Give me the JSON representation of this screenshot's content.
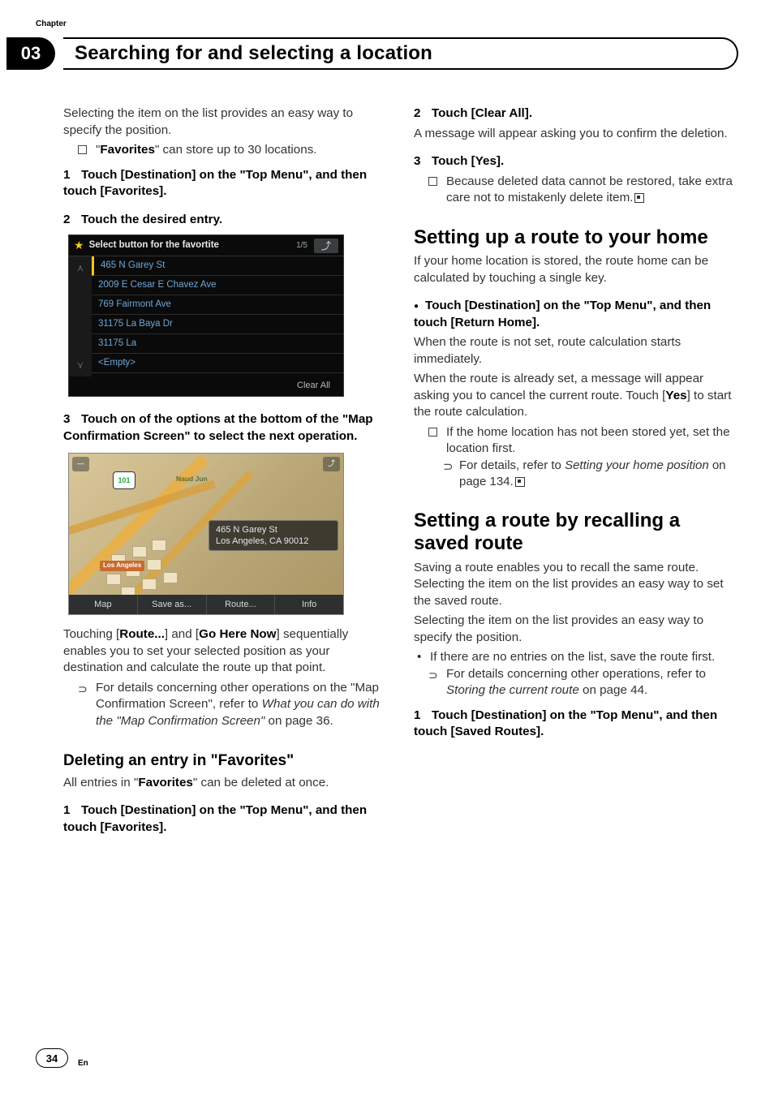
{
  "chapter_label": "Chapter",
  "chapter_number": "03",
  "page_title": "Searching for and selecting a location",
  "page_number": "34",
  "lang_label": "En",
  "left": {
    "intro1": "Selecting the item on the list provides an easy way to specify the position.",
    "note_fav_limit_pre": "\"",
    "note_fav_limit_bold": "Favorites",
    "note_fav_limit_post": "\" can store up to 30 locations.",
    "step1": "Touch [Destination] on the \"Top Menu\", and then touch [Favorites].",
    "step2": "Touch the desired entry.",
    "fav_screen": {
      "title": "Select button for the favortite",
      "page": "1/5",
      "rows": [
        "465 N Garey St",
        "2009 E Cesar E Chavez Ave",
        "769 Fairmont Ave",
        "31175 La Baya Dr",
        "31175 La",
        "<Empty>"
      ],
      "clear": "Clear All"
    },
    "step3": "Touch on of the options at the bottom of the \"Map Confirmation Screen\" to select the next operation.",
    "map_screen": {
      "shield": "101",
      "neighborhood": "Naud Jun",
      "city_label": "Los Angeles",
      "addr_line1": "465 N Garey St",
      "addr_line2": "Los Angeles, CA 90012",
      "buttons": [
        "Map",
        "Save as...",
        "Route...",
        "Info"
      ]
    },
    "route_para_1": "Touching [",
    "route_para_b1": "Route...",
    "route_para_2": "] and [",
    "route_para_b2": "Go Here Now",
    "route_para_3": "] sequentially enables you to set your selected position as your destination and calculate the route up that point.",
    "detail_ref_1": "For details concerning other operations on the \"Map Confirmation Screen\", refer to ",
    "detail_ref_it": "What you can do with the \"Map Confirmation Screen\"",
    "detail_ref_2": " on page 36.",
    "del_heading_1": "Deleting an entry in ",
    "del_heading_2": "\"Favorites\"",
    "del_intro_1": "All entries in \"",
    "del_intro_b": "Favorites",
    "del_intro_2": "\" can be deleted at once.",
    "del_step1": "Touch [Destination] on the \"Top Menu\", and then touch [Favorites]."
  },
  "right": {
    "step2": "Touch [Clear All].",
    "step2_body": "A message will appear asking you to confirm the deletion.",
    "step3": "Touch [Yes].",
    "step3_note": "Because deleted data cannot be restored, take extra care not to mistakenly delete item.",
    "home_heading": "Setting up a route to your home",
    "home_intro": "If your home location is stored, the route home can be calculated by touching a single key.",
    "home_step": "Touch [Destination] on the \"Top Menu\", and then touch [Return Home].",
    "home_body1": "When the route is not set, route calculation starts immediately.",
    "home_body2_a": "When the route is already set, a message will appear asking you to cancel the current route. Touch [",
    "home_body2_b": "Yes",
    "home_body2_c": "] to start the route calculation.",
    "home_note": "If the home location has not been stored yet, set the location first.",
    "home_ref_1": "For details, refer to ",
    "home_ref_it": "Setting your home position",
    "home_ref_2": " on page 134.",
    "recall_heading": "Setting a route by recalling a saved route",
    "recall_p1": "Saving a route enables you to recall the same route. Selecting the item on the list provides an easy way to set the saved route.",
    "recall_p2": "Selecting the item on the list provides an easy way to specify the position.",
    "recall_bullet": "If there are no entries on the list, save the route first.",
    "recall_ref_1": "For details concerning other operations, refer to ",
    "recall_ref_it": "Storing the current route",
    "recall_ref_2": " on page 44.",
    "recall_step1": "Touch [Destination] on the \"Top Menu\", and then touch [Saved Routes]."
  }
}
